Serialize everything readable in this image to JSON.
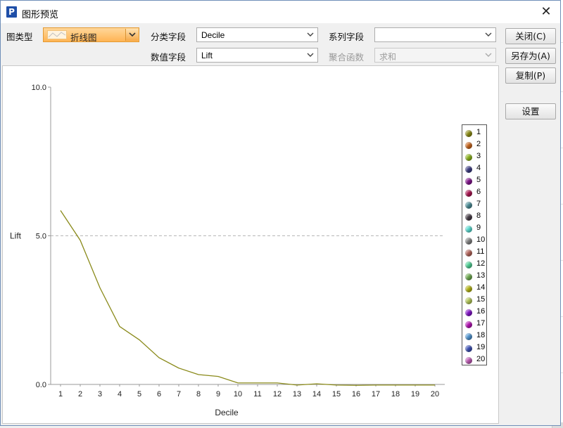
{
  "window": {
    "title": "图形预览",
    "icon_letter": "P",
    "close_glyph": "✕"
  },
  "controls": {
    "chart_type": {
      "label": "图类型",
      "value": "折线图"
    },
    "category_field": {
      "label": "分类字段",
      "value": "Decile"
    },
    "series_field": {
      "label": "系列字段",
      "value": ""
    },
    "value_field": {
      "label": "数值字段",
      "value": "Lift"
    },
    "aggregate": {
      "label": "聚合函数",
      "value": "求和",
      "disabled": true
    }
  },
  "buttons": {
    "close": "关闭(C)",
    "save_as": "另存为(A)",
    "copy": "复制(P)",
    "settings": "设置"
  },
  "colors": {
    "line": "#8a8a1a",
    "grid": "#b8b8b8",
    "accent_orange": "#ffb454"
  },
  "chart_data": {
    "type": "line",
    "xlabel": "Decile",
    "ylabel": "Lift",
    "ylim": [
      0,
      10
    ],
    "yticks": [
      "0.0",
      "5.0",
      "10.0"
    ],
    "grid": true,
    "legend_placement": "right",
    "x": [
      1,
      2,
      3,
      4,
      5,
      6,
      7,
      8,
      9,
      10,
      11,
      12,
      13,
      14,
      15,
      16,
      17,
      18,
      19,
      20
    ],
    "values": [
      5.85,
      4.85,
      3.25,
      1.95,
      1.5,
      0.9,
      0.55,
      0.33,
      0.27,
      0.05,
      0.05,
      0.05,
      -0.02,
      0.02,
      -0.02,
      -0.03,
      -0.02,
      -0.02,
      -0.02,
      -0.02
    ],
    "legend": [
      {
        "label": "1",
        "color": "#8c8c14"
      },
      {
        "label": "2",
        "color": "#c8661e"
      },
      {
        "label": "3",
        "color": "#8cb41e"
      },
      {
        "label": "4",
        "color": "#3c3c82"
      },
      {
        "label": "5",
        "color": "#82148c"
      },
      {
        "label": "6",
        "color": "#aa1450"
      },
      {
        "label": "7",
        "color": "#4b8c96"
      },
      {
        "label": "8",
        "color": "#463c46"
      },
      {
        "label": "9",
        "color": "#5adcd2"
      },
      {
        "label": "10",
        "color": "#828282"
      },
      {
        "label": "11",
        "color": "#b4645a"
      },
      {
        "label": "12",
        "color": "#50d296"
      },
      {
        "label": "13",
        "color": "#6eaa50"
      },
      {
        "label": "14",
        "color": "#b4b414"
      },
      {
        "label": "15",
        "color": "#b4c85a"
      },
      {
        "label": "16",
        "color": "#8214c8"
      },
      {
        "label": "17",
        "color": "#b414b4"
      },
      {
        "label": "18",
        "color": "#5096d2"
      },
      {
        "label": "19",
        "color": "#3c50b4"
      },
      {
        "label": "20",
        "color": "#be5ab4"
      }
    ]
  }
}
